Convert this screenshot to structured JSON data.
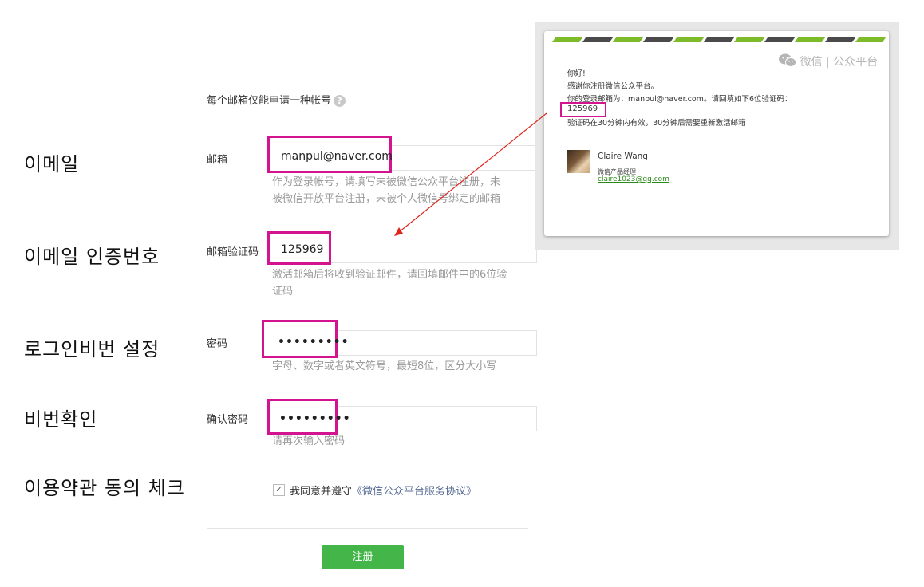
{
  "korean_labels": {
    "email": "이메일",
    "verify": "이메일 인증번호",
    "password": "로그인비번 설정",
    "confirm": "비번확인",
    "agree": "이용약관 동의 체크"
  },
  "form": {
    "notice": "每个邮箱仅能申请一种帐号",
    "help_icon": "?",
    "email_label": "邮箱",
    "email_value": "manpul@naver.com",
    "email_hint_1": "作为登录帐号，请填写未被微信公众平台注册，未",
    "email_hint_2": "被微信开放平台注册，未被个人微信号绑定的邮箱",
    "code_label": "邮箱验证码",
    "code_value": "125969",
    "code_hint_1": "激活邮箱后将收到验证邮件，请回填邮件中的6位验",
    "code_hint_2": "证码",
    "password_label": "密码",
    "password_value": "•••••••••",
    "password_hint": "字母、数字或者英文符号，最短8位，区分大小写",
    "confirm_label": "确认密码",
    "confirm_value": "•••••••••",
    "confirm_hint": "请再次输入密码",
    "agree_text": "我同意并遵守",
    "agree_link": "《微信公众平台服务协议》",
    "checkbox_checked": true,
    "submit_label": "注册"
  },
  "email_preview": {
    "brand_wechat": "微信",
    "brand_sep": "|",
    "brand_platform": "公众平台",
    "greeting": "你好!",
    "thanks": "感谢你注册微信公众平台。",
    "account_line": "你的登录邮箱为：manpul@naver.com。请回填如下6位验证码：",
    "code": "125969",
    "expiry": "验证码在30分钟内有效，30分钟后需要重新激活邮箱",
    "sender_name": "Claire Wang",
    "sender_title": "微信产品经理",
    "sender_email": "claire1023@qq.com"
  },
  "colors": {
    "highlight": "#d4148e",
    "green": "#44b549",
    "stripe_green": "#7dbb2a",
    "stripe_dark": "#4a4a4a",
    "arrow": "#e0241c"
  }
}
